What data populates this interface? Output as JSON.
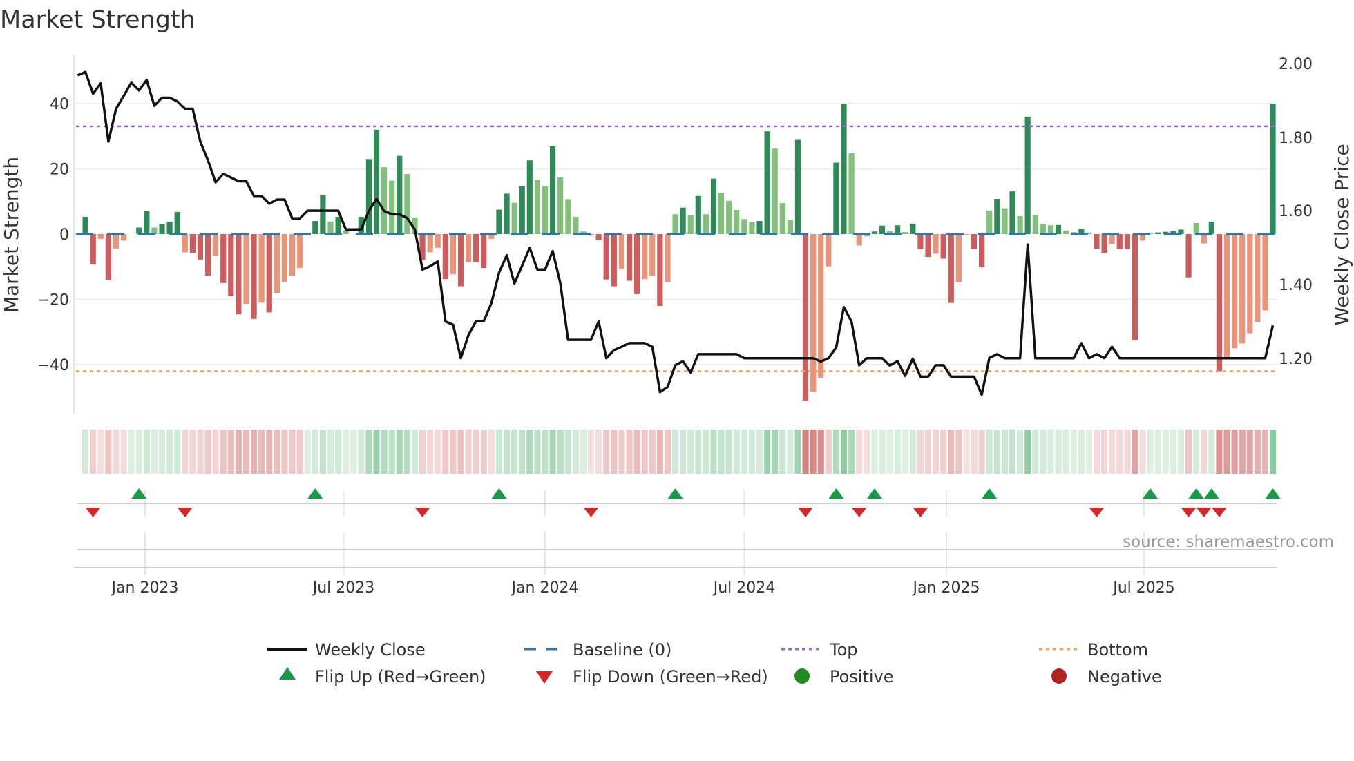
{
  "title": "Market Strength",
  "source": "source: sharemaestro.com",
  "chart_data": {
    "type": "bar",
    "title": "Market Strength",
    "left_axis": {
      "label": "Market Strength",
      "ticks": [
        40,
        20,
        0,
        -20,
        -40
      ],
      "tick_labels": [
        "40",
        "20",
        "0",
        "−20",
        "−40"
      ],
      "ylim": [
        -55,
        55
      ]
    },
    "right_axis": {
      "label": "Weekly Close Price",
      "ticks": [
        2.0,
        1.8,
        1.6,
        1.4,
        1.2
      ],
      "tick_labels": [
        "2.00",
        "1.80",
        "1.60",
        "1.40",
        "1.20"
      ],
      "ylim": [
        1.047,
        2.023
      ]
    },
    "x_tick_labels": [
      "Jan 2023",
      "Jul 2023",
      "Jan 2024",
      "Jul 2024",
      "Jan 2025",
      "Jul 2025"
    ],
    "grid": true,
    "top_level": 33,
    "bottom_level": -42,
    "baseline": 0,
    "strength": [
      5.3,
      -9.3,
      -1.5,
      -14,
      -4.4,
      -2,
      0,
      2,
      7,
      2,
      3,
      3.8,
      6.8,
      -5.6,
      -5.7,
      -7.8,
      -12.7,
      -6.7,
      -15,
      -19,
      -24.6,
      -21.4,
      -26,
      -21,
      -24,
      -18,
      -14.6,
      -12.9,
      -10.4,
      0,
      4,
      12,
      3.8,
      5.3,
      1,
      0,
      5.3,
      23,
      32,
      20.5,
      16.4,
      24,
      18.4,
      5,
      -8,
      -5.6,
      -4.2,
      -13.8,
      -12.3,
      -16,
      -8.6,
      -8.6,
      -10.4,
      -1.5,
      7.5,
      12.4,
      9.6,
      14.7,
      22.6,
      16.6,
      14.6,
      26.9,
      17.4,
      10.7,
      5.3,
      0.8,
      -0.5,
      -1.9,
      -13.9,
      -16,
      -10.8,
      -14.3,
      -18.4,
      -13.8,
      -12.9,
      -22,
      -14.6,
      6.1,
      8.1,
      5.7,
      11.7,
      6.1,
      17,
      12.6,
      10.2,
      7.4,
      4.6,
      3.6,
      4,
      31.5,
      26.2,
      9.5,
      4.3,
      28.9,
      -51,
      -48.3,
      -44,
      -9.9,
      21.9,
      40,
      24.8,
      -3.5,
      -0.7,
      0.8,
      2.6,
      0.9,
      2.7,
      0.6,
      3.2,
      -4.6,
      -7,
      -6,
      -7.5,
      -21.1,
      -14.8,
      -0.3,
      -4.5,
      -10.2,
      7.2,
      10.8,
      7.9,
      13.1,
      5.5,
      36,
      5.9,
      3.1,
      2.7,
      2.8,
      1.1,
      0.6,
      1.6,
      0.5,
      -4.5,
      -5.7,
      -3,
      -4.5,
      -4.5,
      -32.6,
      -2,
      0.4,
      0.5,
      0.7,
      0.9,
      1.4,
      -13.3,
      3.4,
      -2.9,
      3.8,
      -42,
      -37.8,
      -35,
      -33.5,
      -30.4,
      -27,
      -23.4,
      40
    ],
    "weekly_close": [
      1.969,
      1.978,
      1.919,
      1.947,
      1.789,
      1.878,
      1.913,
      1.949,
      1.928,
      1.956,
      1.886,
      1.908,
      1.908,
      1.898,
      1.878,
      1.878,
      1.789,
      1.738,
      1.678,
      1.701,
      1.691,
      1.681,
      1.681,
      1.641,
      1.641,
      1.62,
      1.631,
      1.631,
      1.58,
      1.58,
      1.601,
      1.601,
      1.601,
      1.601,
      1.601,
      1.55,
      1.55,
      1.55,
      1.6,
      1.633,
      1.6,
      1.591,
      1.591,
      1.581,
      1.55,
      1.441,
      1.45,
      1.463,
      1.3,
      1.291,
      1.2,
      1.263,
      1.301,
      1.301,
      1.35,
      1.433,
      1.48,
      1.403,
      1.451,
      1.5,
      1.441,
      1.441,
      1.491,
      1.403,
      1.25,
      1.25,
      1.25,
      1.25,
      1.3,
      1.2,
      1.222,
      1.231,
      1.241,
      1.241,
      1.241,
      1.231,
      1.108,
      1.122,
      1.181,
      1.192,
      1.161,
      1.211,
      1.211,
      1.211,
      1.211,
      1.211,
      1.211,
      1.2,
      1.2,
      1.2,
      1.2,
      1.2,
      1.2,
      1.2,
      1.2,
      1.2,
      1.2,
      1.191,
      1.2,
      1.229,
      1.339,
      1.3,
      1.181,
      1.2,
      1.2,
      1.2,
      1.18,
      1.192,
      1.152,
      1.199,
      1.15,
      1.15,
      1.181,
      1.181,
      1.15,
      1.15,
      1.15,
      1.15,
      1.101,
      1.201,
      1.211,
      1.2,
      1.2,
      1.2,
      1.509,
      1.2,
      1.2,
      1.2,
      1.2,
      1.2,
      1.2,
      1.241,
      1.2,
      1.211,
      1.2,
      1.231,
      1.2,
      1.2,
      1.2,
      1.2,
      1.2,
      1.2,
      1.2,
      1.2,
      1.2,
      1.2,
      1.2,
      1.2,
      1.2,
      1.2,
      1.2,
      1.2,
      1.2,
      1.2,
      1.2,
      1.2,
      1.289
    ],
    "legend": {
      "weekly_close": "Weekly Close",
      "baseline": "Baseline (0)",
      "top": "Top",
      "bottom": "Bottom",
      "flip_up": "Flip Up (Red→Green)",
      "flip_down": "Flip Down (Green→Red)",
      "positive": "Positive",
      "negative": "Negative"
    },
    "colors": {
      "pos_strong": "#2e8b57",
      "pos_weak": "#82c07c",
      "neg_strong": "#cd5c5c",
      "neg_weak": "#e8957a",
      "line": "#111111",
      "baseline": "#2a78b0",
      "top": "#9d63d8",
      "bottom": "#f0a05c",
      "flip_up": "#1a9a48",
      "flip_down": "#d62728",
      "positive": "#228b22",
      "negative": "#b22222"
    }
  }
}
